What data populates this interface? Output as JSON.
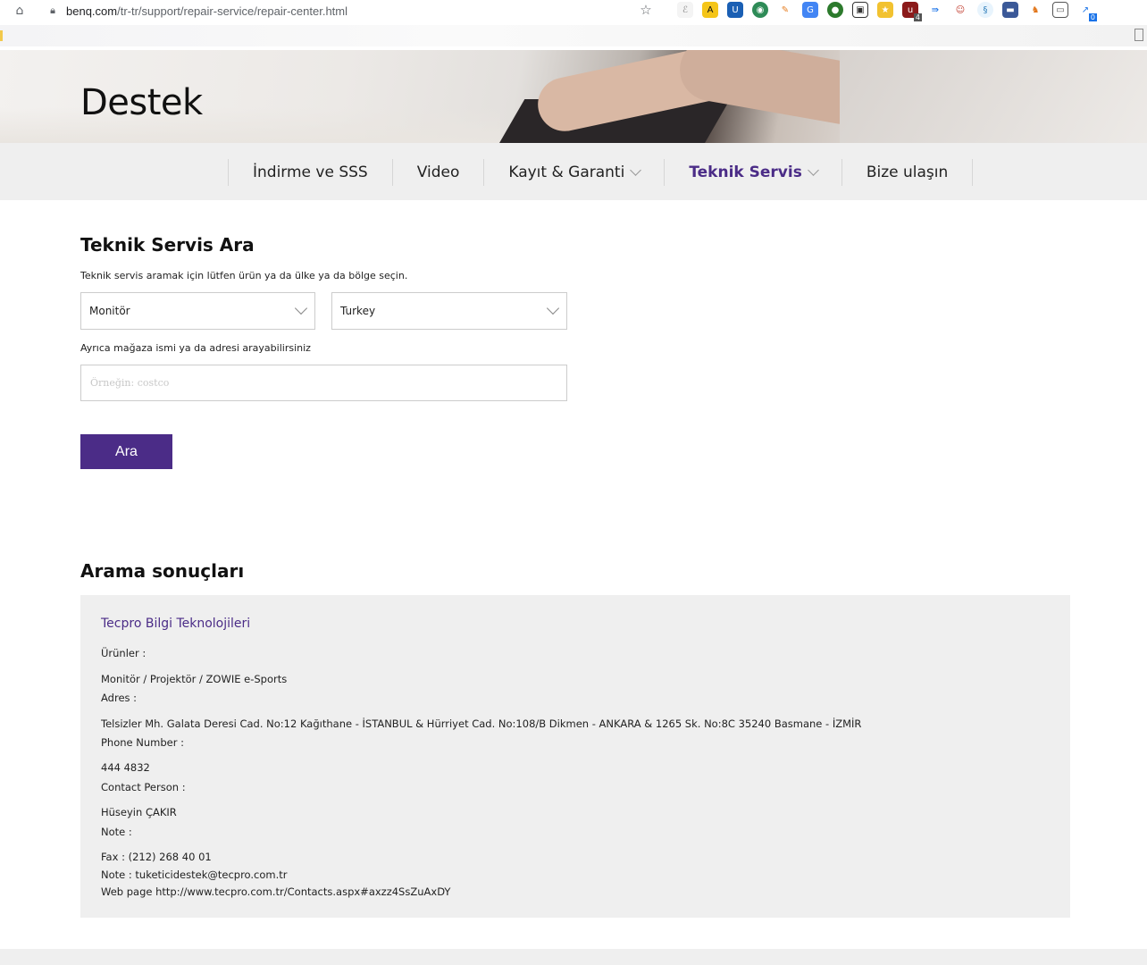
{
  "browser": {
    "url_host": "benq.com",
    "url_path": "/tr-tr/support/repair-service/repair-center.html",
    "extension_badges": [
      "4",
      "0"
    ]
  },
  "hero": {
    "title": "Destek"
  },
  "tabs": [
    {
      "label": "İndirme ve SSS",
      "has_dropdown": false
    },
    {
      "label": "Video",
      "has_dropdown": false
    },
    {
      "label": "Kayıt & Garanti",
      "has_dropdown": true
    },
    {
      "label": "Teknik Servis",
      "has_dropdown": true,
      "active": true
    },
    {
      "label": "Bize ulaşın",
      "has_dropdown": false
    }
  ],
  "search": {
    "title": "Teknik Servis Ara",
    "instruction": "Teknik servis aramak için lütfen ürün ya da ülke ya da bölge seçin.",
    "product_select": "Monitör",
    "country_select": "Turkey",
    "store_hint": "Ayrıca mağaza ismi ya da adresi arayabilirsiniz",
    "store_placeholder": "Örneğin: costco",
    "button": "Ara"
  },
  "results": {
    "title": "Arama sonuçları",
    "items": [
      {
        "name": "Tecpro Bilgi Teknolojileri",
        "products_label": "Ürünler :",
        "products": "Monitör / Projektör / ZOWIE e-Sports",
        "address_label": "Adres :",
        "address": "Telsizler Mh. Galata Deresi Cad. No:12 Kağıthane - İSTANBUL & Hürriyet Cad. No:108/B Dikmen - ANKARA & 1265 Sk. No:8C 35240 Basmane - İZMİR",
        "phone_label": "Phone Number :",
        "phone": "444 4832",
        "contact_label": "Contact Person :",
        "contact": "Hüseyin ÇAKIR",
        "note_label": "Note :",
        "note_lines": [
          "Fax : (212) 268 40 01",
          "Note : tuketicidestek@tecpro.com.tr",
          "Web page http://www.tecpro.com.tr/Contacts.aspx#axzz4SsZuAxDY"
        ]
      }
    ]
  }
}
